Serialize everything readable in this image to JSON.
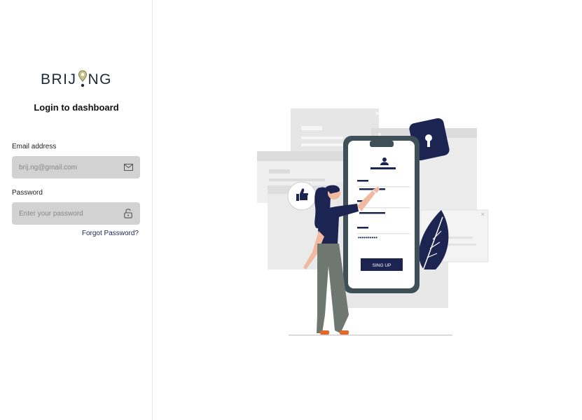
{
  "brand": {
    "logo_text_left": "BRIJ",
    "logo_text_right": "NG"
  },
  "login": {
    "title": "Login to dashboard"
  },
  "email": {
    "label": "Email address",
    "placeholder": "brij.ng@gmail.com",
    "icon": "mail-icon"
  },
  "password": {
    "label": "Password",
    "placeholder": "Enter your password",
    "icon": "unlock-icon"
  },
  "forgot_password": "Forgot Password?",
  "illustration": {
    "signup_button_label": "SING UP",
    "password_dots": "••••••••••"
  },
  "colors": {
    "accent": "#1c2451",
    "field_bg": "#d2d2d2",
    "phone_frame": "#3e4f57"
  }
}
